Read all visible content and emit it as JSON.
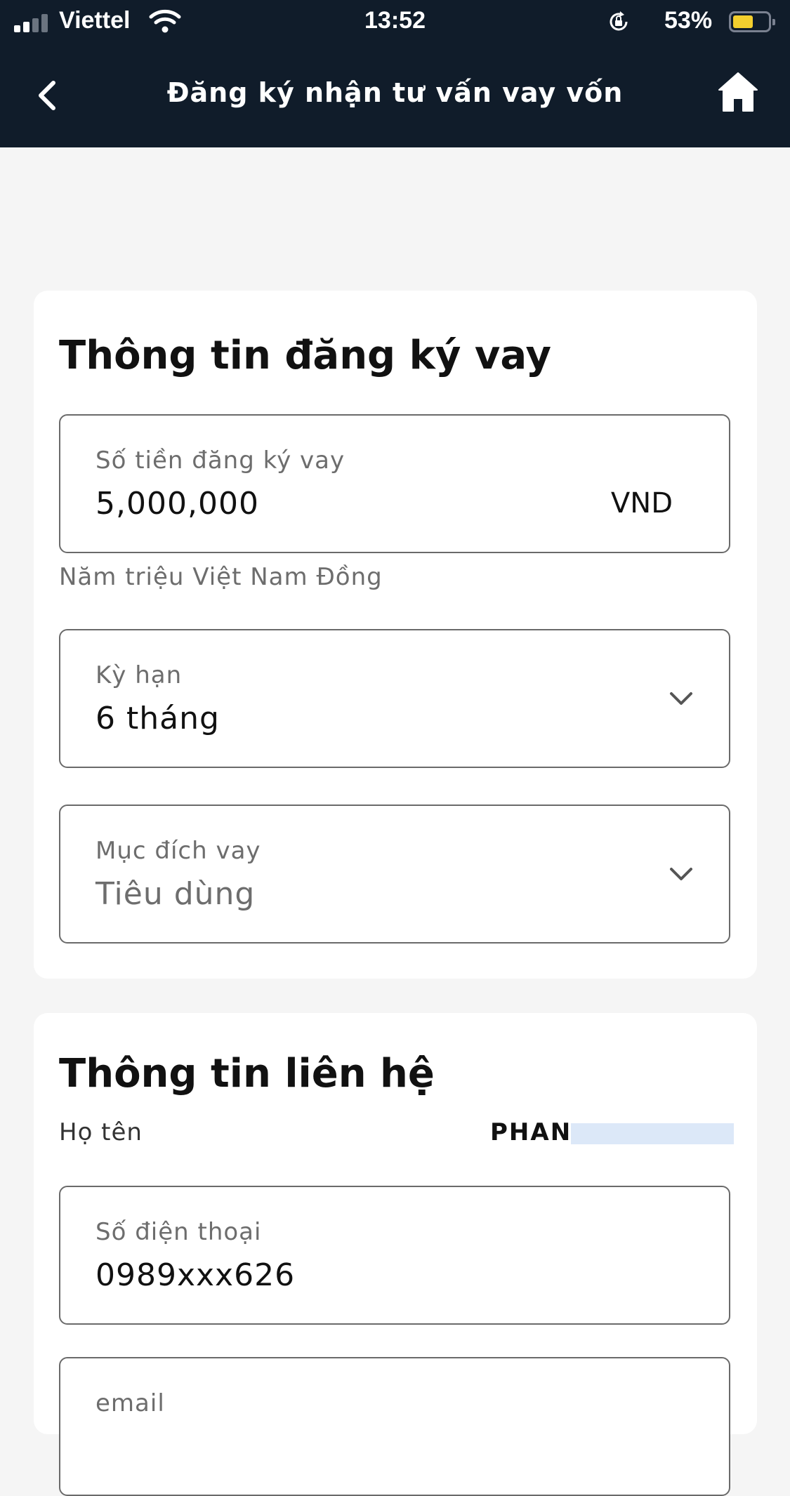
{
  "status_bar": {
    "carrier": "Viettel",
    "time": "13:52",
    "battery": "53%",
    "icons": [
      "signal-icon",
      "wifi-icon",
      "orientation-lock-icon",
      "battery-icon"
    ],
    "battery_color": "#f3cf2e"
  },
  "nav": {
    "title": "Đăng ký nhận tư vấn vay vốn",
    "back_icon": "chevron-left-icon",
    "home_icon": "home-icon",
    "bg_color": "#101c2a"
  },
  "loan": {
    "title": "Thông tin đăng ký vay",
    "amount": {
      "label": "Số tiền đăng ký vay",
      "value": "5,000,000",
      "unit": "VND"
    },
    "amount_in_words": "Năm triệu Việt Nam Đồng",
    "term": {
      "label": "Kỳ hạn",
      "value": "6 tháng"
    },
    "purpose": {
      "label": "Mục đích vay",
      "value": "Tiêu dùng"
    }
  },
  "contact": {
    "title": "Thông tin liên hệ",
    "name_label": "Họ tên",
    "name_value": "PHAN",
    "phone": {
      "label": "Số điện thoại",
      "value": "0989xxx626"
    },
    "email": {
      "label": "email"
    }
  }
}
